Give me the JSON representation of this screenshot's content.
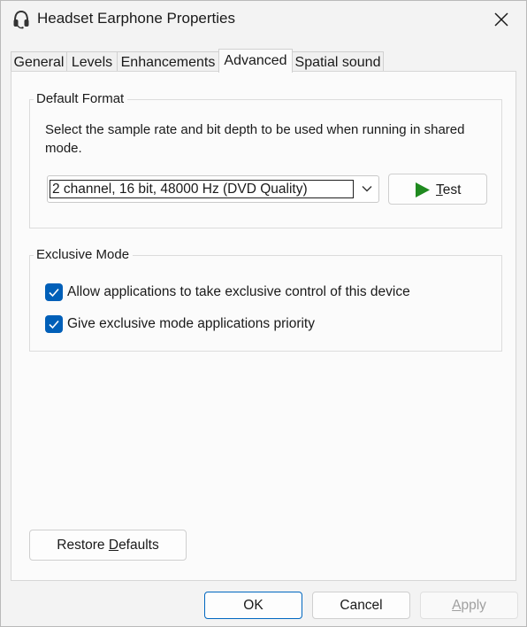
{
  "window": {
    "title": "Headset Earphone Properties",
    "icon": "headset-icon"
  },
  "tabs": [
    {
      "label": "General",
      "active": false
    },
    {
      "label": "Levels",
      "active": false
    },
    {
      "label": "Enhancements",
      "active": false
    },
    {
      "label": "Advanced",
      "active": true
    },
    {
      "label": "Spatial sound",
      "active": false
    }
  ],
  "default_format": {
    "legend": "Default Format",
    "description_line1": "Select the sample rate and bit depth to be used when running in shared",
    "description_line2": "mode.",
    "selected_format": "2 channel, 16 bit, 48000 Hz (DVD Quality)",
    "test_label_mnemonic": "T",
    "test_label_rest": "est"
  },
  "exclusive_mode": {
    "legend": "Exclusive Mode",
    "options": [
      {
        "label": "Allow applications to take exclusive control of this device",
        "checked": true
      },
      {
        "label": "Give exclusive mode applications priority",
        "checked": true
      }
    ]
  },
  "restore": {
    "label_before": "Restore ",
    "label_mnemonic": "D",
    "label_after": "efaults"
  },
  "footer": {
    "ok_label": "OK",
    "cancel_label": "Cancel",
    "apply_mnemonic": "A",
    "apply_rest": "pply",
    "apply_enabled": false
  },
  "colors": {
    "accent": "#005fb8",
    "play_green": "#1f8a1f"
  }
}
